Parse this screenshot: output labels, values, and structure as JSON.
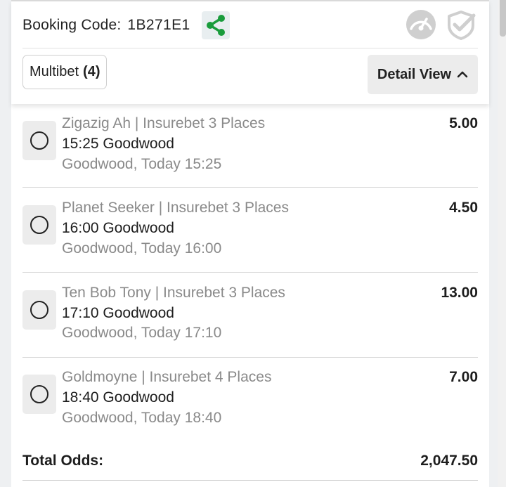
{
  "booking": {
    "label": "Booking Code:",
    "code": "1B271E1",
    "share_icon": "share-icon",
    "share_color": "#1a9c3c"
  },
  "header_icons": {
    "speed_icon": "speedometer-icon",
    "check_icon": "shield-check-icon",
    "icon_color": "#c8c8c8"
  },
  "tabs": {
    "multibet_label": "Multibet",
    "multibet_count": "(4)"
  },
  "detail_view": {
    "label": "Detail View",
    "icon": "chevron-up-icon"
  },
  "selections": [
    {
      "title": "Zigazig Ah | Insurebet 3 Places",
      "event": "15:25 Goodwood",
      "time": "Goodwood, Today 15:25",
      "odds": "5.00"
    },
    {
      "title": "Planet Seeker | Insurebet 3 Places",
      "event": "16:00 Goodwood",
      "time": "Goodwood, Today 16:00",
      "odds": "4.50"
    },
    {
      "title": "Ten Bob Tony | Insurebet 3 Places",
      "event": "17:10 Goodwood",
      "time": "Goodwood, Today 17:10",
      "odds": "13.00"
    },
    {
      "title": "Goldmoyne | Insurebet 4 Places",
      "event": "18:40 Goodwood",
      "time": "Goodwood, Today 18:40",
      "odds": "7.00"
    }
  ],
  "total": {
    "label": "Total Odds:",
    "value": "2,047.50"
  }
}
